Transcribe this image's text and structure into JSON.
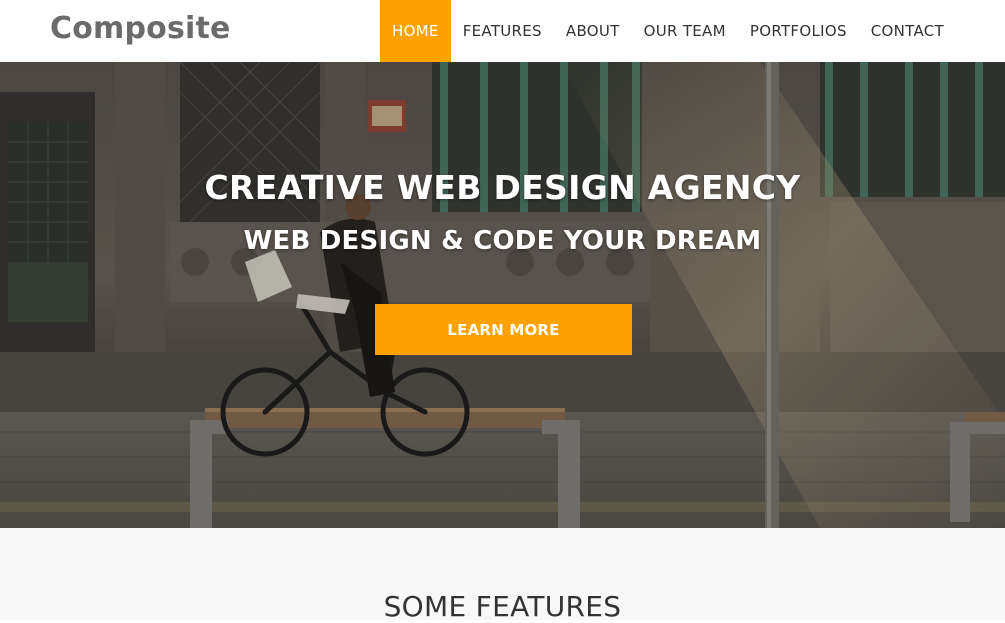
{
  "brand": {
    "name": "Composite"
  },
  "nav": {
    "items": [
      {
        "label": "HOME",
        "active": true
      },
      {
        "label": "FEATURES",
        "active": false
      },
      {
        "label": "ABOUT",
        "active": false
      },
      {
        "label": "OUR TEAM",
        "active": false
      },
      {
        "label": "PORTFOLIOS",
        "active": false
      },
      {
        "label": "CONTACT",
        "active": false
      }
    ]
  },
  "hero": {
    "title": "CREATIVE WEB DESIGN AGENCY",
    "subtitle": "WEB DESIGN & CODE YOUR DREAM",
    "cta_label": "LEARN MORE",
    "image_subject": "cyclist riding past a bench on a city sidewalk"
  },
  "features": {
    "title": "SOME FEATURES"
  },
  "colors": {
    "accent": "#ffa200",
    "nav_text": "#333333",
    "brand_text": "#6b6b6b",
    "section_bg": "#f8f8f8"
  }
}
